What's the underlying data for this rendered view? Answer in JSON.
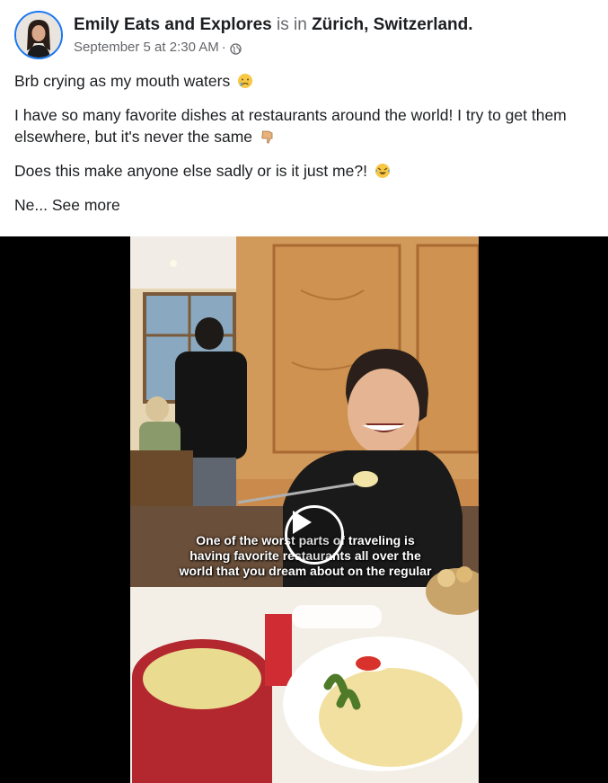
{
  "post": {
    "author": "Emily Eats and Explores",
    "is_in_text": "is in",
    "location": "Zürich, Switzerland.",
    "timestamp": "September 5 at 2:30 AM",
    "separator": "·",
    "privacy_icon": "globe-icon",
    "paragraphs": [
      {
        "text": "Brb crying as my mouth waters",
        "emoji": "crying-face-emoji"
      },
      {
        "text": "I have so many favorite dishes at restaurants around the world! I try to get them elsewhere, but it's never the same",
        "emoji": "thumbs-down-emoji"
      },
      {
        "text": "Does this make anyone else sadly or is it just me?!",
        "emoji": "rolling-laughing-emoji"
      }
    ],
    "truncated_text": "Ne...",
    "see_more_label": "See more"
  },
  "video": {
    "caption": "One of the worst parts of traveling is having favorite restaurants all over the world that you dream about on the regular",
    "play_icon": "play-icon"
  },
  "colors": {
    "accent": "#1877f2",
    "text_primary": "#1c1e21",
    "text_secondary": "#65676b",
    "video_bg": "#000000"
  }
}
